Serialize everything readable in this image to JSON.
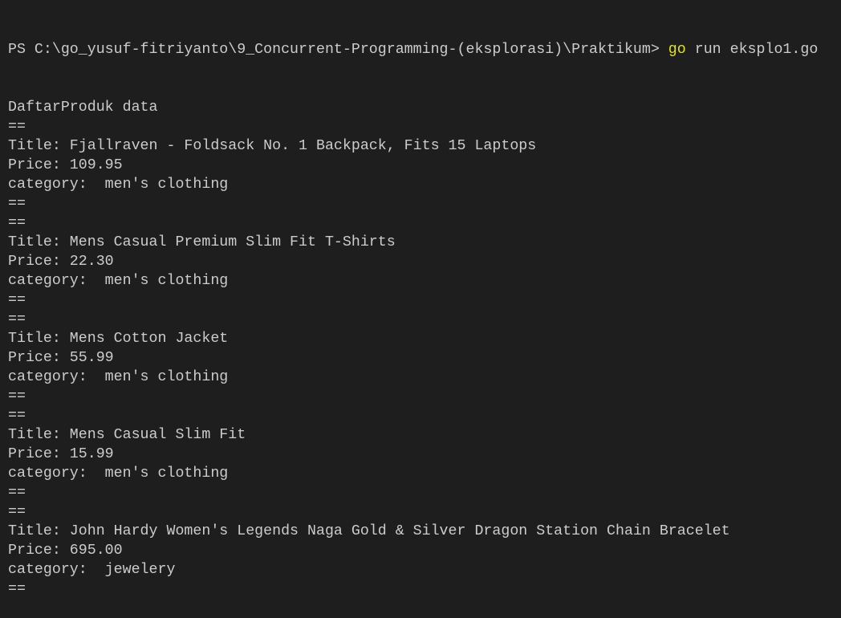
{
  "prompt": "PS C:\\go_yusuf-fitriyanto\\9_Concurrent-Programming-(eksplorasi)\\Praktikum> ",
  "command": "go",
  "args": " run eksplo1.go",
  "colors": {
    "background": "#1e1e1e",
    "text": "#cccccc",
    "command": "#e5e510"
  },
  "output": [
    "DaftarProduk data",
    "==",
    "Title: Fjallraven - Foldsack No. 1 Backpack, Fits 15 Laptops",
    "Price: 109.95",
    "category:  men's clothing",
    "==",
    "==",
    "Title: Mens Casual Premium Slim Fit T-Shirts",
    "Price: 22.30",
    "category:  men's clothing",
    "==",
    "==",
    "Title: Mens Cotton Jacket",
    "Price: 55.99",
    "category:  men's clothing",
    "==",
    "==",
    "Title: Mens Casual Slim Fit",
    "Price: 15.99",
    "category:  men's clothing",
    "==",
    "==",
    "Title: John Hardy Women's Legends Naga Gold & Silver Dragon Station Chain Bracelet",
    "Price: 695.00",
    "category:  jewelery",
    "=="
  ]
}
